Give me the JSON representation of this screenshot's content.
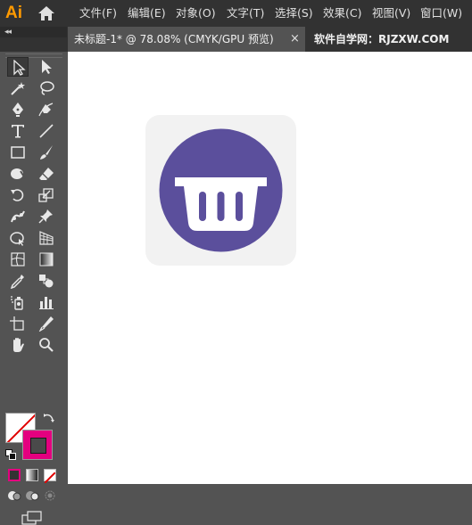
{
  "app": {
    "logo": "Ai"
  },
  "menubar": {
    "items": [
      "文件(F)",
      "编辑(E)",
      "对象(O)",
      "文字(T)",
      "选择(S)",
      "效果(C)",
      "视图(V)",
      "窗口(W)"
    ]
  },
  "tabs": {
    "document_title": "未标题-1* @ 78.08% (CMYK/GPU 预览)",
    "close_glyph": "×",
    "collapse_glyph": "◂◂"
  },
  "watermark": "软件自学网：RJZXW.COM",
  "tools": [
    [
      "selection-tool",
      "direct-selection-tool"
    ],
    [
      "magic-wand-tool",
      "lasso-tool"
    ],
    [
      "pen-tool",
      "curvature-tool"
    ],
    [
      "type-tool",
      "line-segment-tool"
    ],
    [
      "rectangle-tool",
      "paintbrush-tool"
    ],
    [
      "shaper-tool",
      "eraser-tool"
    ],
    [
      "rotate-tool",
      "scale-tool"
    ],
    [
      "puppet-warp-tool",
      "pin-tool"
    ],
    [
      "free-transform-tool",
      "perspective-grid-tool"
    ],
    [
      "mesh-tool",
      "gradient-tool"
    ],
    [
      "eyedropper-tool",
      "blend-tool"
    ],
    [
      "symbol-sprayer-tool",
      "column-graph-tool"
    ],
    [
      "artboard-tool",
      "slice-tool"
    ],
    [
      "hand-tool",
      "zoom-tool"
    ]
  ],
  "colors": {
    "fill": "none",
    "stroke": "#e4007f",
    "icon_background": "#f2f2f2",
    "circle": "#5b4f9c",
    "basket": "#ffffff",
    "accent": "#ff9a00"
  },
  "artwork": {
    "icon": "shopping-basket-icon"
  }
}
